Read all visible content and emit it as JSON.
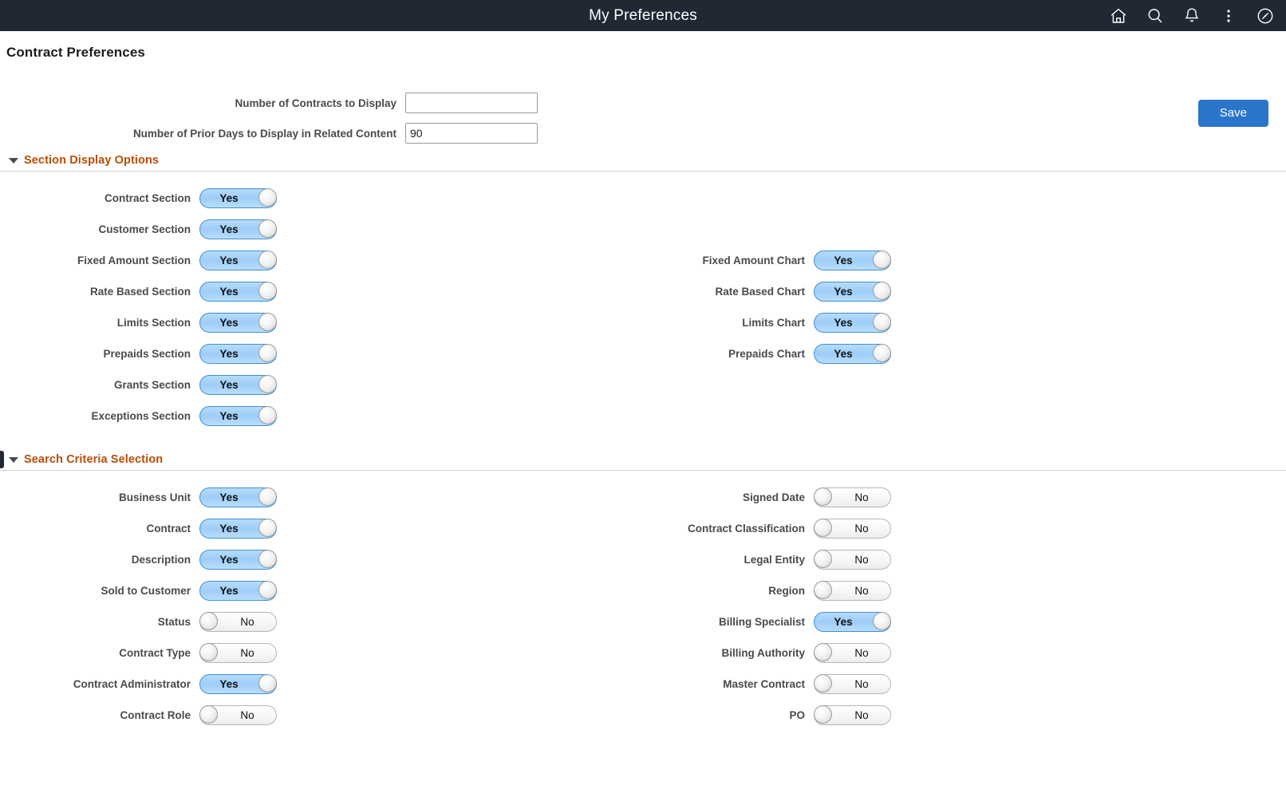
{
  "topbar": {
    "title": "My Preferences",
    "icons": [
      {
        "name": "home-icon",
        "label": "Home"
      },
      {
        "name": "search-icon",
        "label": "Search"
      },
      {
        "name": "notifications-bell-icon",
        "label": "Notifications"
      },
      {
        "name": "actions-kebab-icon",
        "label": "Actions"
      },
      {
        "name": "navigator-compass-icon",
        "label": "NavBar"
      }
    ],
    "background_color": "#1f2833"
  },
  "page": {
    "title": "Contract Preferences",
    "save_label": "Save",
    "save_color": "#2a74cc",
    "section_title_color": "#b84d05"
  },
  "fields": [
    {
      "label": "Number of Contracts to Display",
      "value": "",
      "placeholder": ""
    },
    {
      "label": "Number of Prior Days to Display in Related Content",
      "value": "90",
      "placeholder": ""
    }
  ],
  "sections": [
    {
      "title": "Section Display Options",
      "left": [
        {
          "label": "Contract Section",
          "value": "Yes",
          "on": true
        },
        {
          "label": "Customer Section",
          "value": "Yes",
          "on": true
        },
        {
          "label": "Fixed Amount Section",
          "value": "Yes",
          "on": true
        },
        {
          "label": "Rate Based Section",
          "value": "Yes",
          "on": true
        },
        {
          "label": "Limits Section",
          "value": "Yes",
          "on": true
        },
        {
          "label": "Prepaids Section",
          "value": "Yes",
          "on": true
        },
        {
          "label": "Grants Section",
          "value": "Yes",
          "on": true
        },
        {
          "label": "Exceptions Section",
          "value": "Yes",
          "on": true
        }
      ],
      "right": [
        {
          "label": "Fixed Amount Chart",
          "value": "Yes",
          "on": true,
          "row": 2
        },
        {
          "label": "Rate Based Chart",
          "value": "Yes",
          "on": true,
          "row": 3
        },
        {
          "label": "Limits Chart",
          "value": "Yes",
          "on": true,
          "row": 4
        },
        {
          "label": "Prepaids Chart",
          "value": "Yes",
          "on": true,
          "row": 5
        }
      ]
    },
    {
      "title": "Search Criteria Selection",
      "left": [
        {
          "label": "Business Unit",
          "value": "Yes",
          "on": true
        },
        {
          "label": "Contract",
          "value": "Yes",
          "on": true
        },
        {
          "label": "Description",
          "value": "Yes",
          "on": true
        },
        {
          "label": "Sold to Customer",
          "value": "Yes",
          "on": true
        },
        {
          "label": "Status",
          "value": "No",
          "on": false
        },
        {
          "label": "Contract Type",
          "value": "No",
          "on": false
        },
        {
          "label": "Contract Administrator",
          "value": "Yes",
          "on": true
        },
        {
          "label": "Contract Role",
          "value": "No",
          "on": false
        }
      ],
      "right": [
        {
          "label": "Signed Date",
          "value": "No",
          "on": false,
          "row": 0
        },
        {
          "label": "Contract Classification",
          "value": "No",
          "on": false,
          "row": 1
        },
        {
          "label": "Legal Entity",
          "value": "No",
          "on": false,
          "row": 2
        },
        {
          "label": "Region",
          "value": "No",
          "on": false,
          "row": 3
        },
        {
          "label": "Billing Specialist",
          "value": "Yes",
          "on": true,
          "row": 4
        },
        {
          "label": "Billing Authority",
          "value": "No",
          "on": false,
          "row": 5
        },
        {
          "label": "Master Contract",
          "value": "No",
          "on": false,
          "row": 6
        },
        {
          "label": "PO",
          "value": "No",
          "on": false,
          "row": 7
        }
      ]
    }
  ]
}
